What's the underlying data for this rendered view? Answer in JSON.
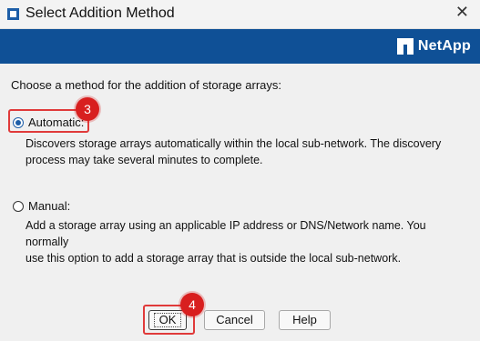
{
  "window": {
    "title": "Select Addition Method",
    "close_glyph": "✕"
  },
  "banner": {
    "logo_text": "NetApp"
  },
  "main": {
    "prompt": "Choose a method for the addition of storage arrays:",
    "options": [
      {
        "label": "Automatic:",
        "selected": true,
        "description": [
          "Discovers storage arrays automatically within the local sub-network. The discovery",
          "process may take several minutes to complete."
        ]
      },
      {
        "label": "Manual:",
        "selected": false,
        "description": [
          "Add a storage array using an applicable IP address or DNS/Network name. You normally",
          "use this option to add a storage array that is outside the local sub-network."
        ]
      }
    ]
  },
  "buttons": {
    "ok": "OK",
    "cancel": "Cancel",
    "help": "Help"
  },
  "annotations": {
    "step_automatic": "3",
    "step_ok": "4",
    "color": "#e03a3a"
  },
  "colors": {
    "banner": "#0f5096",
    "accent": "#1d5ea8"
  }
}
